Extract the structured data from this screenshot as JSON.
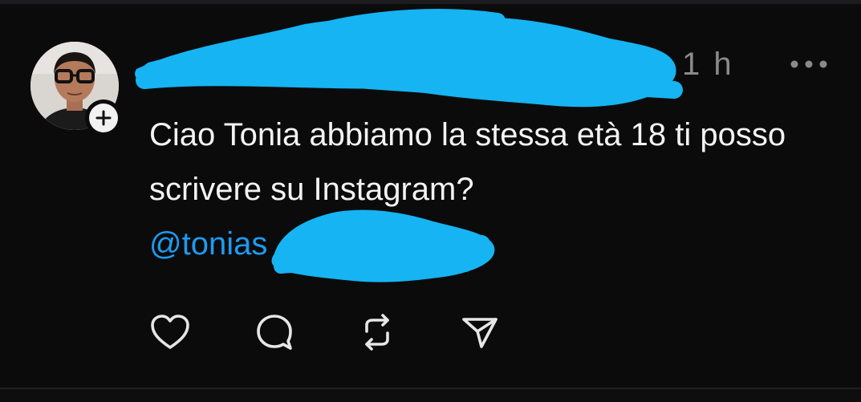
{
  "post": {
    "username": "",
    "timestamp": "1 h",
    "text": "Ciao Tonia abbiamo la stessa età 18 ti posso scrivere su Instagram?",
    "mention": "@tonias"
  },
  "icons": {
    "follow": "plus-icon",
    "more": "more-horizontal-icon",
    "like": "heart-icon",
    "reply": "comment-icon",
    "repost": "repost-icon",
    "share": "send-icon"
  },
  "colors": {
    "background": "#0b0b0c",
    "text": "#f3f3f3",
    "muted": "#8a8a8a",
    "link": "#1d9bf0",
    "redaction": "#16b4f2"
  }
}
